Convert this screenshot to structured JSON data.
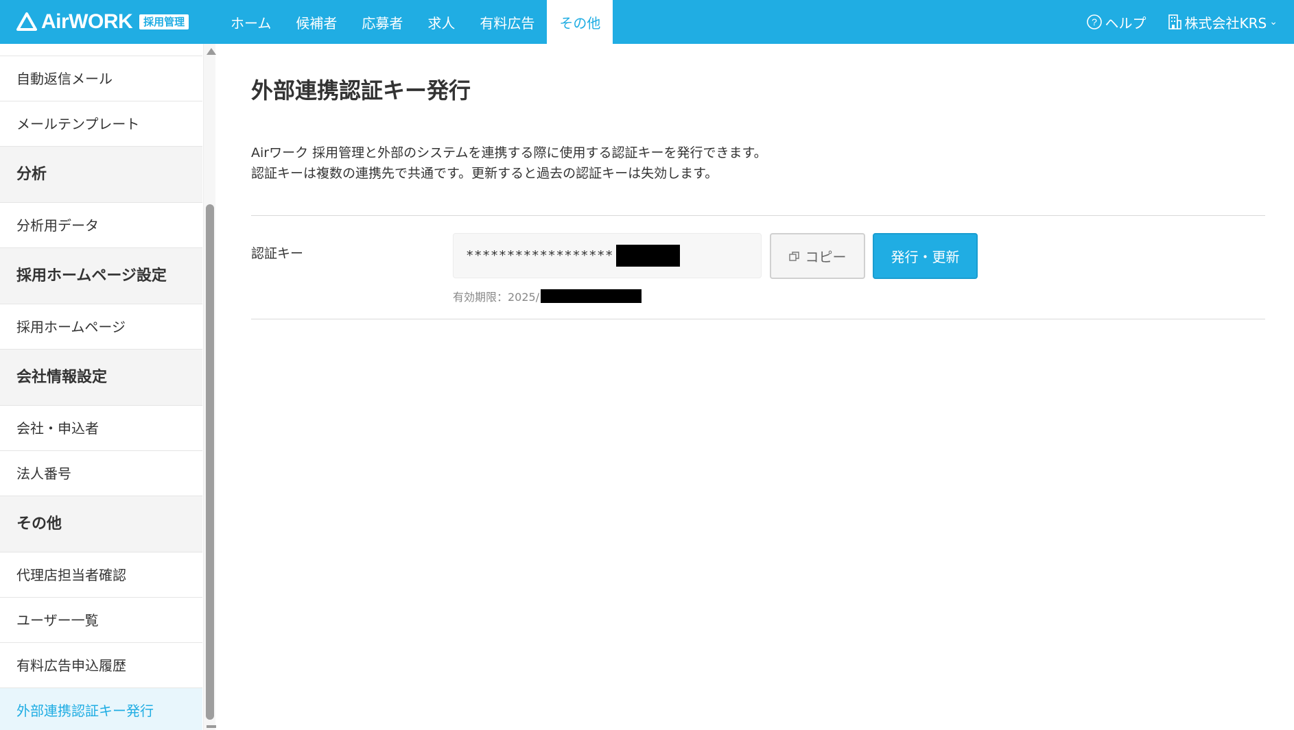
{
  "header": {
    "logo_text": "AirWORK",
    "logo_badge": "採用管理",
    "nav": [
      {
        "label": "ホーム"
      },
      {
        "label": "候補者"
      },
      {
        "label": "応募者"
      },
      {
        "label": "求人"
      },
      {
        "label": "有料広告"
      },
      {
        "label": "その他"
      }
    ],
    "help_label": "ヘルプ",
    "company_label": "株式会社KRS"
  },
  "sidebar": {
    "items": [
      {
        "label": "自動返信メール",
        "kind": "item"
      },
      {
        "label": "メールテンプレート",
        "kind": "item"
      },
      {
        "label": "分析",
        "kind": "section"
      },
      {
        "label": "分析用データ",
        "kind": "item"
      },
      {
        "label": "採用ホームページ設定",
        "kind": "section"
      },
      {
        "label": "採用ホームページ",
        "kind": "item"
      },
      {
        "label": "会社情報設定",
        "kind": "section"
      },
      {
        "label": "会社・申込者",
        "kind": "item"
      },
      {
        "label": "法人番号",
        "kind": "item"
      },
      {
        "label": "その他",
        "kind": "section"
      },
      {
        "label": "代理店担当者確認",
        "kind": "item"
      },
      {
        "label": "ユーザー一覧",
        "kind": "item"
      },
      {
        "label": "有料広告申込履歴",
        "kind": "item"
      },
      {
        "label": "外部連携認証キー発行",
        "kind": "item"
      }
    ]
  },
  "main": {
    "title": "外部連携認証キー発行",
    "desc_line1": "Airワーク 採用管理と外部のシステムを連携する際に使用する認証キーを発行できます。",
    "desc_line2": "認証キーは複数の連携先で共通です。更新すると過去の認証キーは失効します。",
    "key_label": "認証キー",
    "key_masked": "******************",
    "copy_label": "コピー",
    "issue_label": "発行・更新",
    "expiry_prefix": "有効期限：2025/"
  }
}
